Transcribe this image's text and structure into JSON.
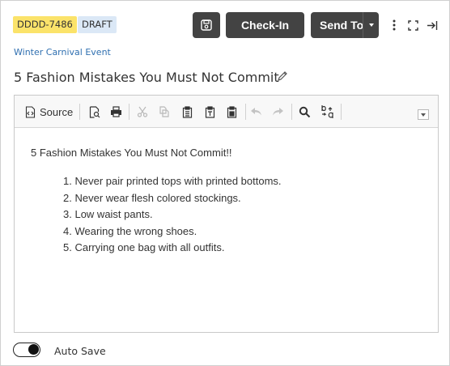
{
  "header": {
    "doc_id": "DDDD-7486",
    "status": "DRAFT",
    "checkin_label": "Check-In",
    "sendto_label": "Send To",
    "event_link": "Winter Carnival Event",
    "title": "5 Fashion Mistakes You Must Not Commit"
  },
  "toolbar": {
    "source_label": "Source",
    "buttons": [
      "source",
      "preview",
      "print",
      "cut",
      "copy",
      "paste",
      "paste-text",
      "paste-word",
      "undo",
      "redo",
      "find",
      "replace",
      "more"
    ]
  },
  "content": {
    "paragraph": "5 Fashion Mistakes You Must Not Commit!!",
    "list": [
      {
        "num": "1.",
        "text": "Never pair printed tops with printed bottoms."
      },
      {
        "num": "2.",
        "text": "Never wear flesh colored stockings."
      },
      {
        "num": "3.",
        "text": "Low waist pants."
      },
      {
        "num": "4.",
        "text": "Wearing the wrong shoes."
      },
      {
        "num": "5.",
        "text": "Carrying one bag with all outfits."
      }
    ]
  },
  "footer": {
    "autosave_label": "Auto Save",
    "autosave_on": true
  },
  "colors": {
    "id_badge": "#fbe36a",
    "status_badge": "#dbe8f6",
    "dark_button": "#434343",
    "link": "#2f6fb0"
  }
}
